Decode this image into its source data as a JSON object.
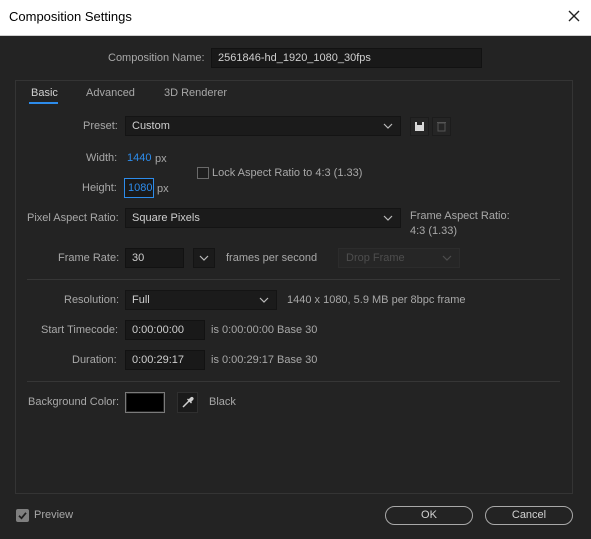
{
  "window": {
    "title": "Composition Settings"
  },
  "comp_name": {
    "label": "Composition Name:",
    "value": "2561846-hd_1920_1080_30fps"
  },
  "tabs": [
    {
      "label": "Basic"
    },
    {
      "label": "Advanced"
    },
    {
      "label": "3D Renderer"
    }
  ],
  "preset": {
    "label": "Preset:",
    "value": "Custom"
  },
  "width": {
    "label": "Width:",
    "value": "1440",
    "unit": "px"
  },
  "height": {
    "label": "Height:",
    "value": "1080",
    "unit": "px"
  },
  "lock_aspect": {
    "label": "Lock Aspect Ratio to 4:3 (1.33)",
    "checked": false
  },
  "pixel_aspect": {
    "label": "Pixel Aspect Ratio:",
    "value": "Square Pixels"
  },
  "frame_aspect": {
    "label": "Frame Aspect Ratio:",
    "value": "4:3 (1.33)"
  },
  "frame_rate": {
    "label": "Frame Rate:",
    "value": "30",
    "unit": "frames per second",
    "drop_frame": "Drop Frame"
  },
  "resolution": {
    "label": "Resolution:",
    "value": "Full",
    "info": "1440 x 1080, 5.9 MB per 8bpc frame"
  },
  "start_timecode": {
    "label": "Start Timecode:",
    "value": "0:00:00:00",
    "info": "is 0:00:00:00  Base 30"
  },
  "duration": {
    "label": "Duration:",
    "value": "0:00:29:17",
    "info": "is 0:00:29:17  Base 30"
  },
  "background": {
    "label": "Background Color:",
    "color": "#000000",
    "name": "Black"
  },
  "preview": {
    "label": "Preview",
    "checked": true
  },
  "buttons": {
    "ok": "OK",
    "cancel": "Cancel"
  },
  "colors": {
    "accent": "#2d8ceb",
    "background": "#232323",
    "field": "#191919"
  }
}
